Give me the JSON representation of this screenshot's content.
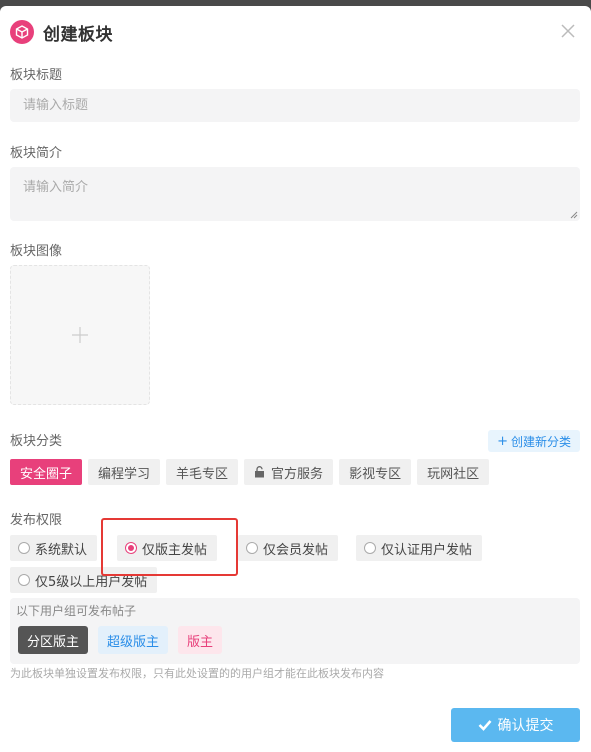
{
  "dialog": {
    "title": "创建板块"
  },
  "fields": {
    "title_label": "板块标题",
    "title_placeholder": "请输入标题",
    "intro_label": "板块简介",
    "intro_placeholder": "请输入简介",
    "image_label": "板块图像",
    "category_label": "板块分类",
    "add_category": "创建新分类"
  },
  "categories": [
    "安全圈子",
    "编程学习",
    "羊毛专区",
    "官方服务",
    "影视专区",
    "玩网社区"
  ],
  "selected_category": "安全圈子",
  "permission": {
    "label": "发布权限",
    "options": [
      "系统默认",
      "仅版主发帖",
      "仅会员发帖",
      "仅认证用户发帖",
      "仅5级以上用户发帖"
    ],
    "selected": "仅版主发帖",
    "group_title": "以下用户组可发布帖子",
    "groups": [
      "分区版主",
      "超级版主",
      "版主"
    ],
    "hint": "为此板块单独设置发布权限，只有此处设置的的用户组才能在此板块发布内容"
  },
  "submit_label": "确认提交",
  "colors": {
    "accent": "#e8407b",
    "primary": "#5bb8f0",
    "highlight": "#e53935"
  }
}
